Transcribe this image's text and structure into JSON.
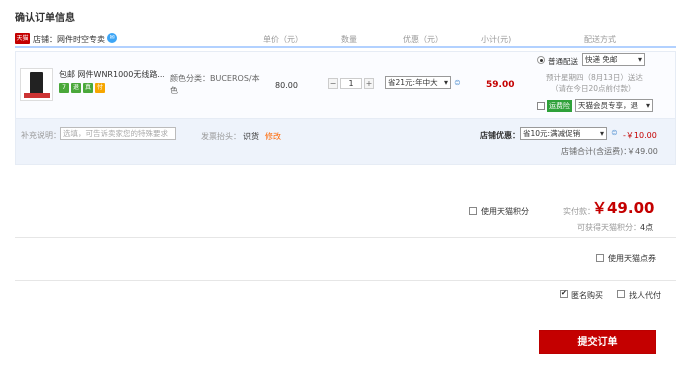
{
  "page_title": "确认订单信息",
  "columns": {
    "unit_price": "单价（元）",
    "quantity": "数量",
    "discount": "优惠（元）",
    "subtotal": "小计(元)",
    "delivery": "配送方式"
  },
  "shop": {
    "badge": "天猫",
    "label": "店铺：",
    "name": "网件时空专卖"
  },
  "item": {
    "name": "包邮 网件WNR1000无线路...",
    "sku_label": "颜色分类：BUCEROS/本色",
    "unit_price": "80.00",
    "quantity": "1",
    "qty_minus": "−",
    "qty_plus": "+",
    "discount_option": "省21元:年中大",
    "subtotal": "59.00",
    "badges": [
      {
        "label": "7",
        "color": "#4aa83a"
      },
      {
        "label": "退",
        "color": "#4aa83a"
      },
      {
        "label": "真",
        "color": "#4aa83a"
      },
      {
        "label": "付",
        "color": "#f7a600"
      }
    ]
  },
  "delivery": {
    "normal_label": "普通配送",
    "option": "快递 免邮",
    "estimate_line1": "预计星期四（8月13日）送达",
    "estimate_line2": "（请在今日20点前付款）",
    "insurance_tag": "运费险",
    "insurance_option": "天猫会员专享，退"
  },
  "note": {
    "label": "补充说明：",
    "placeholder": "选填，可告诉卖家您的特殊要求",
    "invoice_label": "发票抬头：",
    "invoice_value": "识货",
    "invoice_edit": "修改"
  },
  "shop_discount": {
    "label": "店铺优惠：",
    "option": "省10元:满减促销",
    "amount": "-￥10.00",
    "total_label": "店铺合计(含运费)：",
    "total_value": "￥49.00"
  },
  "payment": {
    "use_points_label": "使用天猫积分",
    "paid_label": "实付款：",
    "paid_amount": "￥49.00",
    "earn_points_label": "可获得天猫积分：",
    "earn_points_value": "4点",
    "use_coupon_label": "使用天猫点券",
    "anonymous_label": "匿名购买",
    "anonymous_checked": true,
    "proxy_label": "找人代付",
    "submit_label": "提交订单"
  },
  "colors": {
    "brand_red": "#c40000",
    "header_border": "#b2d1ff",
    "row_bg": "#eef3fb",
    "insurance_green": "#2fa13a"
  }
}
